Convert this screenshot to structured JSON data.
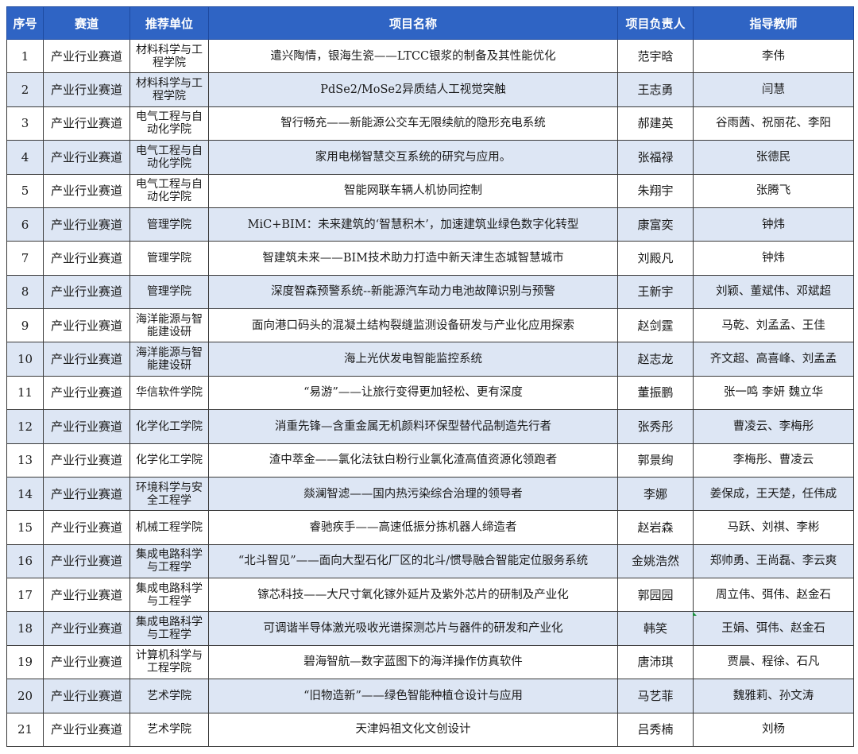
{
  "table": {
    "headers": [
      "序号",
      "赛道",
      "推荐单位",
      "项目名称",
      "项目负责人",
      "指导教师"
    ],
    "rows": [
      [
        "1",
        "产业行业赛道",
        "材料科学与工程学院",
        "遣兴陶情，银海生瓷——LTCC银浆的制备及其性能优化",
        "范宇晗",
        "李伟"
      ],
      [
        "2",
        "产业行业赛道",
        "材料科学与工程学院",
        "PdSe2/MoSe2异质结人工视觉突触",
        "王志勇",
        "闫慧"
      ],
      [
        "3",
        "产业行业赛道",
        "电气工程与自动化学院",
        "智行畅充——新能源公交车无限续航的隐形充电系统",
        "郝建英",
        "谷雨茜、祝丽花、李阳"
      ],
      [
        "4",
        "产业行业赛道",
        "电气工程与自动化学院",
        "家用电梯智慧交互系统的研究与应用。",
        "张福禄",
        "张德民"
      ],
      [
        "5",
        "产业行业赛道",
        "电气工程与自动化学院",
        "智能网联车辆人机协同控制",
        "朱翔宇",
        "张腾飞"
      ],
      [
        "6",
        "产业行业赛道",
        "管理学院",
        "MiC+BIM：未来建筑的‘智慧积木’，加速建筑业绿色数字化转型",
        "康富奕",
        "钟炜"
      ],
      [
        "7",
        "产业行业赛道",
        "管理学院",
        "智建筑未来——BIM技术助力打造中新天津生态城智慧城市",
        "刘殿凡",
        "钟炜"
      ],
      [
        "8",
        "产业行业赛道",
        "管理学院",
        "深度智森预警系统--新能源汽车动力电池故障识别与预警",
        "王新宇",
        "刘颖、董斌伟、邓斌超"
      ],
      [
        "9",
        "产业行业赛道",
        "海洋能源与智能建设研",
        "面向港口码头的混凝土结构裂缝监测设备研发与产业化应用探索",
        "赵剑霆",
        "马乾、刘孟孟、王佳"
      ],
      [
        "10",
        "产业行业赛道",
        "海洋能源与智能建设研",
        "海上光伏发电智能监控系统",
        "赵志龙",
        "齐文超、高喜峰、刘孟孟"
      ],
      [
        "11",
        "产业行业赛道",
        "华信软件学院",
        "“易游”——让旅行变得更加轻松、更有深度",
        "董振鹏",
        "张一鸣 李妍 魏立华"
      ],
      [
        "12",
        "产业行业赛道",
        "化学化工学院",
        "消重先锋—含重金属无机颜料环保型替代品制造先行者",
        "张秀彤",
        "曹凌云、李梅彤"
      ],
      [
        "13",
        "产业行业赛道",
        "化学化工学院",
        "渣中萃金——氯化法钛白粉行业氯化渣高值资源化领跑者",
        "郭景绚",
        "李梅彤、曹凌云"
      ],
      [
        "14",
        "产业行业赛道",
        "环境科学与安全工程学",
        "燚澜智滤——国内热污染综合治理的领导者",
        "李娜",
        "姜保成，王天楚，任伟成"
      ],
      [
        "15",
        "产业行业赛道",
        "机械工程学院",
        "睿驰疾手——高速低振分拣机器人缔造者",
        "赵岩森",
        "马跃、刘祺、李彬"
      ],
      [
        "16",
        "产业行业赛道",
        "集成电路科学与工程学",
        "“北斗智见”——面向大型石化厂区的北斗/惯导融合智能定位服务系统",
        "金姚浩然",
        "郑帅勇、王尚磊、李云爽"
      ],
      [
        "17",
        "产业行业赛道",
        "集成电路科学与工程学",
        "镓芯科技——大尺寸氧化镓外延片及紫外芯片的研制及产业化",
        "郭园园",
        "周立伟、弭伟、赵金石"
      ],
      [
        "18",
        "产业行业赛道",
        "集成电路科学与工程学",
        "可调谐半导体激光吸收光谱探测芯片与器件的研发和产业化",
        "韩笑",
        "王娟、弭伟、赵金石"
      ],
      [
        "19",
        "产业行业赛道",
        "计算机科学与工程学院",
        "碧海智航—数字蓝图下的海洋操作仿真软件",
        "唐沛琪",
        "贾晨、程徐、石凡"
      ],
      [
        "20",
        "产业行业赛道",
        "艺术学院",
        "“旧物造新”——绿色智能种植仓设计与应用",
        "马艺菲",
        "魏雅莉、孙文涛"
      ],
      [
        "21",
        "产业行业赛道",
        "艺术学院",
        "天津妈祖文化文创设计",
        "吕秀楠",
        "刘杨"
      ]
    ]
  }
}
